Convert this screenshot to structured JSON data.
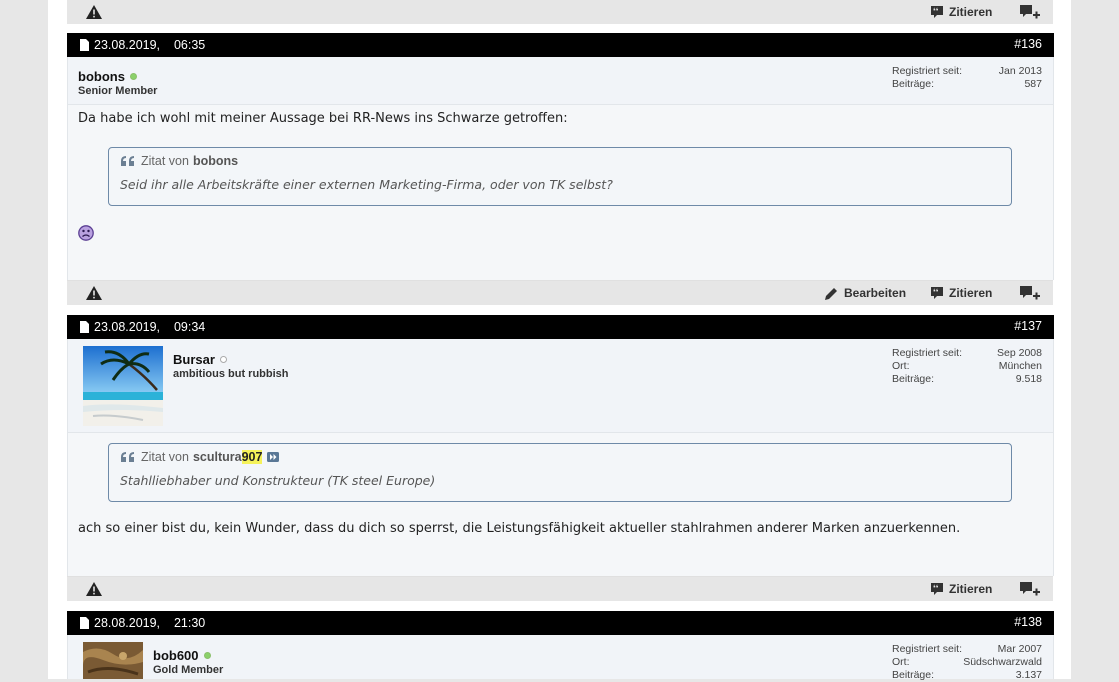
{
  "toolbar": {
    "quote_label": "Zitieren",
    "edit_label": "Bearbeiten"
  },
  "posts": [
    {
      "date": "23.08.2019,",
      "time": "06:35",
      "number": "#136",
      "user": {
        "name": "bobons",
        "title": "Senior Member",
        "online": true
      },
      "stats": [
        {
          "label": "Registriert seit:",
          "value": "Jan 2013"
        },
        {
          "label": "Beiträge:",
          "value": "587"
        }
      ],
      "text": "Da habe ich wohl mit meiner Aussage bei RR-News ins Schwarze getroffen:",
      "quote": {
        "prefix": "Zitat von",
        "author": "bobons",
        "text": "Seid ihr alle Arbeitskräfte einer externen Marketing-Firma, oder von TK selbst?"
      },
      "smiley": "sad-smiley"
    },
    {
      "date": "23.08.2019,",
      "time": "09:34",
      "number": "#137",
      "user": {
        "name": "Bursar",
        "title": "ambitious but rubbish",
        "online": false
      },
      "stats": [
        {
          "label": "Registriert seit:",
          "value": "Sep 2008"
        },
        {
          "label": "Ort:",
          "value": "München"
        },
        {
          "label": "Beiträge:",
          "value": "9.518"
        }
      ],
      "quote": {
        "prefix": "Zitat von",
        "author_a": "scultura",
        "author_b": "907",
        "text": "Stahlliebhaber und Konstrukteur (TK steel Europe)"
      },
      "text": "ach so einer bist du, kein Wunder, dass du dich so sperrst, die Leistungsfähigkeit aktueller stahlrahmen anderer Marken anzuerkennen."
    },
    {
      "date": "28.08.2019,",
      "time": "21:30",
      "number": "#138",
      "user": {
        "name": "bob600",
        "title": "Gold Member",
        "online": true
      },
      "stats": [
        {
          "label": "Registriert seit:",
          "value": "Mar 2007"
        },
        {
          "label": "Ort:",
          "value": "Südschwarzwald"
        },
        {
          "label": "Beiträge:",
          "value": "3.137"
        }
      ]
    }
  ],
  "colors": {
    "header_bg": "#000000",
    "userbar_bg": "#f1f4f8",
    "quote_border": "#6e8aa8",
    "highlight": "#f5f25a"
  }
}
